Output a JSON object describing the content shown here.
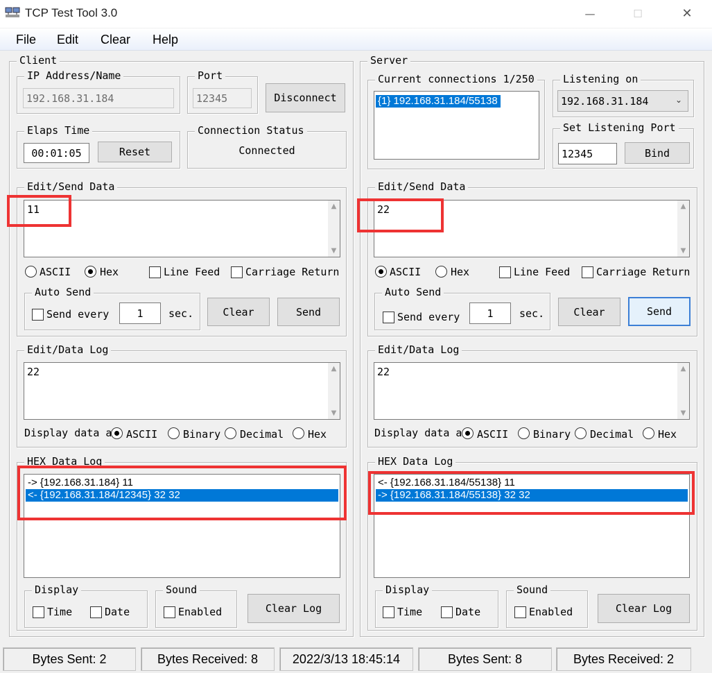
{
  "window": {
    "title": "TCP Test Tool 3.0",
    "controls": {
      "minimize": "—",
      "maximize": "☐",
      "close": "✕"
    }
  },
  "menu": [
    "File",
    "Edit",
    "Clear",
    "Help"
  ],
  "client": {
    "group_label": "Client",
    "ip": {
      "label": "IP Address/Name",
      "value": "192.168.31.184"
    },
    "port": {
      "label": "Port",
      "value": "12345"
    },
    "disconnect_label": "Disconnect",
    "elaps": {
      "label": "Elaps Time",
      "value": "00:01:05",
      "reset_label": "Reset"
    },
    "conn_status": {
      "label": "Connection Status",
      "value": "Connected"
    },
    "edit_send": {
      "label": "Edit/Send Data",
      "text": "11",
      "mode_ascii": "ASCII",
      "mode_hex": "Hex",
      "selected_mode": "Hex",
      "line_feed": "Line Feed",
      "carriage_return": "Carriage Return",
      "auto_send": {
        "label": "Auto Send",
        "send_every": "Send every",
        "interval": "1",
        "unit": "sec."
      },
      "clear_label": "Clear",
      "send_label": "Send"
    },
    "data_log": {
      "label": "Edit/Data Log",
      "text": "22",
      "display_label": "Display data a",
      "opt_ascii": "ASCII",
      "opt_binary": "Binary",
      "opt_decimal": "Decimal",
      "opt_hex": "Hex",
      "selected": "ASCII"
    },
    "hex_log": {
      "label": "HEX Data Log",
      "rows": [
        {
          "text": "-> {192.168.31.184} 11",
          "selected": false
        },
        {
          "text": "<- {192.168.31.184/12345} 32 32",
          "selected": true
        }
      ]
    },
    "display": {
      "label": "Display",
      "time": "Time",
      "date": "Date"
    },
    "sound": {
      "label": "Sound",
      "enabled": "Enabled"
    },
    "clear_log_label": "Clear Log"
  },
  "server": {
    "group_label": "Server",
    "connections": {
      "label": "Current connections 1/250",
      "items": [
        "{1} 192.168.31.184/55138"
      ]
    },
    "listening": {
      "label": "Listening on",
      "value": "192.168.31.184"
    },
    "set_port": {
      "label": "Set Listening Port",
      "value": "12345",
      "bind_label": "Bind"
    },
    "edit_send": {
      "label": "Edit/Send Data",
      "text": "22",
      "mode_ascii": "ASCII",
      "mode_hex": "Hex",
      "selected_mode": "ASCII",
      "line_feed": "Line Feed",
      "carriage_return": "Carriage Return",
      "auto_send": {
        "label": "Auto Send",
        "send_every": "Send every",
        "interval": "1",
        "unit": "sec."
      },
      "clear_label": "Clear",
      "send_label": "Send"
    },
    "data_log": {
      "label": "Edit/Data Log",
      "text": "22",
      "display_label": "Display data a",
      "opt_ascii": "ASCII",
      "opt_binary": "Binary",
      "opt_decimal": "Decimal",
      "opt_hex": "Hex",
      "selected": "ASCII"
    },
    "hex_log": {
      "label": "HEX Data Log",
      "rows": [
        {
          "text": "<- {192.168.31.184/55138} 11",
          "selected": false
        },
        {
          "text": "-> {192.168.31.184/55138} 32 32",
          "selected": true
        }
      ]
    },
    "display": {
      "label": "Display",
      "time": "Time",
      "date": "Date"
    },
    "sound": {
      "label": "Sound",
      "enabled": "Enabled"
    },
    "clear_log_label": "Clear Log"
  },
  "status_bar": [
    "Bytes Sent: 2",
    "Bytes Received: 8",
    "2022/3/13 18:45:14",
    "Bytes Sent: 8",
    "Bytes Received: 2"
  ],
  "colors": {
    "selection": "#0078d7",
    "annotation_red": "#ee3333",
    "focus_border": "#3c7fd6"
  }
}
